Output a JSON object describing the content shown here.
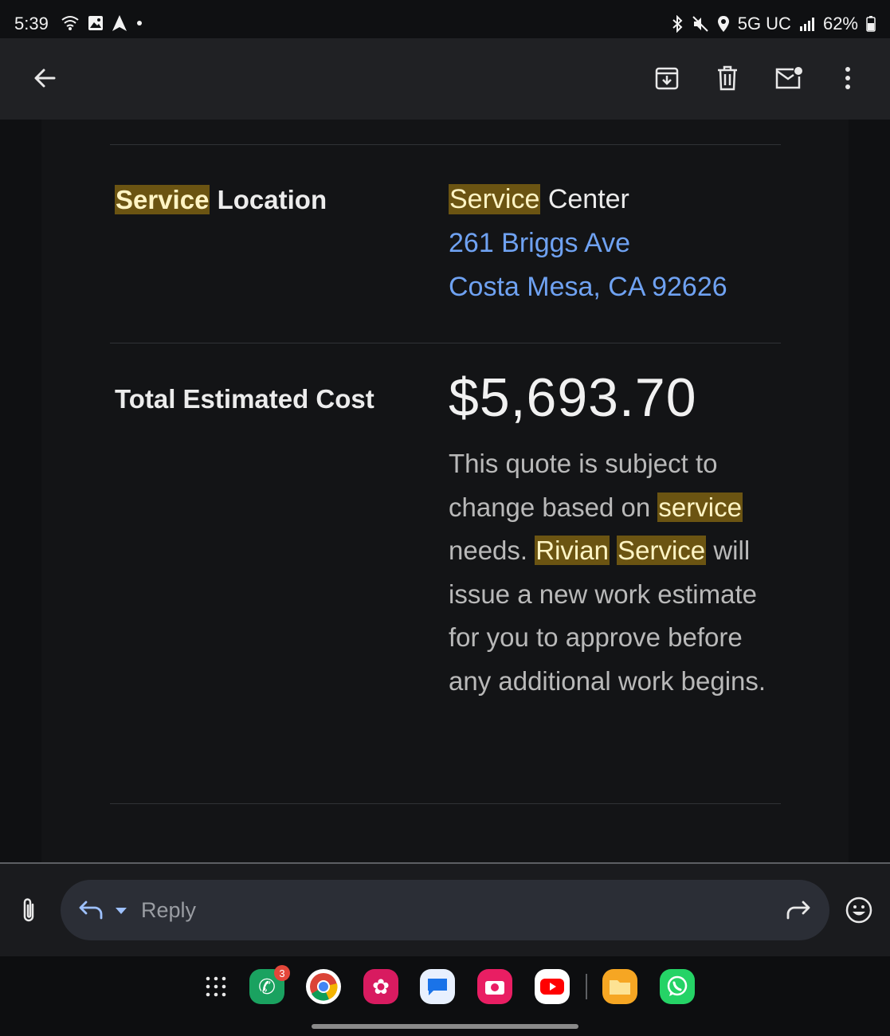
{
  "status_bar": {
    "time": "5:39",
    "network": "5G UC",
    "battery": "62%"
  },
  "toolbar": {
    "back_icon": "arrow-back-icon",
    "archive_icon": "archive-icon",
    "delete_icon": "trash-icon",
    "mark_unread_icon": "mail-unread-icon",
    "more_icon": "more-vert-icon"
  },
  "email": {
    "service_location": {
      "label_highlight": "Service",
      "label_rest": " Location",
      "name_highlight": "Service",
      "name_rest": " Center",
      "address_line1": "261 Briggs Ave",
      "address_line2": "Costa Mesa, CA 92626"
    },
    "total": {
      "label": "Total Estimated Cost",
      "amount": "$5,693.70",
      "note_1": "This quote is subject to change based on ",
      "note_hl_1": "service",
      "note_2": " needs. ",
      "note_hl_2": "Rivian",
      "note_3": " ",
      "note_hl_3": "Service",
      "note_4": " will issue a new work estimate for you to approve before any additional work begins."
    },
    "highlight_color": "#6b5412",
    "link_color": "#6fa2f2"
  },
  "reply_bar": {
    "placeholder": "Reply"
  },
  "dock": {
    "phone_badge": "3",
    "apps": [
      "phone",
      "chrome",
      "blossom",
      "messages",
      "camera",
      "youtube",
      "files",
      "whatsapp"
    ]
  }
}
